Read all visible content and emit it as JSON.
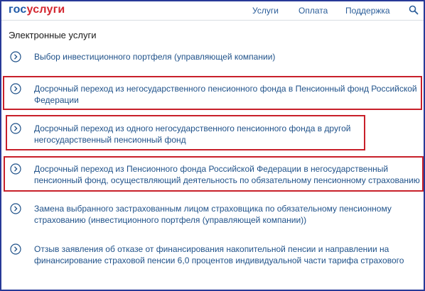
{
  "header": {
    "logo": {
      "part1": "гос",
      "part2": "услуги"
    },
    "nav": [
      "Услуги",
      "Оплата",
      "Поддержка"
    ]
  },
  "section": {
    "title": "Электронные услуги"
  },
  "services": [
    {
      "line1": "Выбор инвестиционного портфеля (управляющей компании)",
      "line2": ""
    },
    {
      "line1": "Досрочный переход из негосударственного пенсионного фонда в Пенсионный фонд Российской",
      "line2": "Федерации"
    },
    {
      "line1": "Досрочный переход из одного негосударственного пенсионного фонда в другой",
      "line2": "негосударственный пенсионный фонд"
    },
    {
      "line1": "Досрочный переход из Пенсионного фонда Российской Федерации в негосударственный",
      "line2": "пенсионный фонд, осуществляющий деятельность по обязательному пенсионному страхованию"
    },
    {
      "line1": "Замена выбранного застрахованным лицом страховщика по обязательному пенсионному",
      "line2": "страхованию (инвестиционного портфеля (управляющей компании))"
    },
    {
      "line1": "Отзыв заявления об отказе от финансирования накопительной пенсии и направлении на",
      "line2": "финансирование страховой пенсии 6,0 процентов индивидуальной части тарифа страхового"
    }
  ],
  "colors": {
    "frame": "#283a98",
    "link": "#1f5189",
    "highlight": "#c8202a",
    "logo_blue": "#1f5aa8",
    "logo_red": "#d3262f"
  },
  "icons": {
    "search": "search-icon",
    "item": "chevron-right-circle-icon"
  }
}
